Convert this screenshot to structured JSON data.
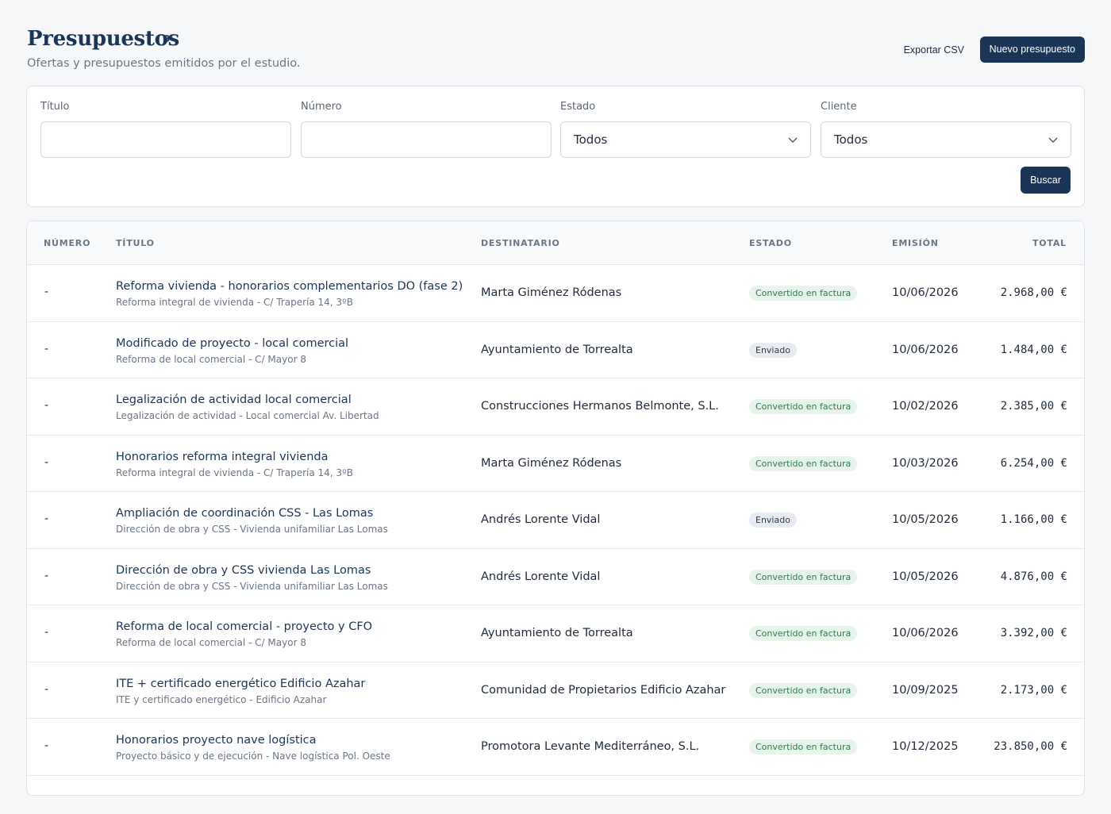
{
  "header": {
    "title": "Presupuestos",
    "count": "9",
    "subtitle": "Ofertas y presupuestos emitidos por el estudio.",
    "export_label": "Exportar CSV",
    "new_label": "Nuevo presupuesto"
  },
  "filters": {
    "title_label": "Título",
    "title_value": "",
    "number_label": "Número",
    "number_value": "",
    "status_label": "Estado",
    "status_value": "Todos",
    "client_label": "Cliente",
    "client_value": "Todos",
    "search_label": "Buscar"
  },
  "table": {
    "columns": {
      "number": "NÚMERO",
      "title": "TÍTULO",
      "recipient": "DESTINATARIO",
      "status": "ESTADO",
      "issued": "EMISIÓN",
      "total": "TOTAL"
    },
    "rows": [
      {
        "number": "-",
        "title": "Reforma vivienda - honorarios complementarios DO (fase 2)",
        "subtitle": "Reforma integral de vivienda - C/ Trapería 14, 3ºB",
        "recipient": "Marta Giménez Ródenas",
        "status": "Convertido en factura",
        "date": "10/06/2026",
        "total": "2.968,00 €"
      },
      {
        "number": "-",
        "title": "Modificado de proyecto - local comercial",
        "subtitle": "Reforma de local comercial - C/ Mayor 8",
        "recipient": "Ayuntamiento de Torrealta",
        "status": "Enviado",
        "date": "10/06/2026",
        "total": "1.484,00 €"
      },
      {
        "number": "-",
        "title": "Legalización de actividad local comercial",
        "subtitle": "Legalización de actividad - Local comercial Av. Libertad",
        "recipient": "Construcciones Hermanos Belmonte, S.L.",
        "status": "Convertido en factura",
        "date": "10/02/2026",
        "total": "2.385,00 €"
      },
      {
        "number": "-",
        "title": "Honorarios reforma integral vivienda",
        "subtitle": "Reforma integral de vivienda - C/ Trapería 14, 3ºB",
        "recipient": "Marta Giménez Ródenas",
        "status": "Convertido en factura",
        "date": "10/03/2026",
        "total": "6.254,00 €"
      },
      {
        "number": "-",
        "title": "Ampliación de coordinación CSS - Las Lomas",
        "subtitle": "Dirección de obra y CSS - Vivienda unifamiliar Las Lomas",
        "recipient": "Andrés Lorente Vidal",
        "status": "Enviado",
        "date": "10/05/2026",
        "total": "1.166,00 €"
      },
      {
        "number": "-",
        "title": "Dirección de obra y CSS vivienda Las Lomas",
        "subtitle": "Dirección de obra y CSS - Vivienda unifamiliar Las Lomas",
        "recipient": "Andrés Lorente Vidal",
        "status": "Convertido en factura",
        "date": "10/05/2026",
        "total": "4.876,00 €"
      },
      {
        "number": "-",
        "title": "Reforma de local comercial - proyecto y CFO",
        "subtitle": "Reforma de local comercial - C/ Mayor 8",
        "recipient": "Ayuntamiento de Torrealta",
        "status": "Convertido en factura",
        "date": "10/06/2026",
        "total": "3.392,00 €"
      },
      {
        "number": "-",
        "title": "ITE + certificado energético Edificio Azahar",
        "subtitle": "ITE y certificado energético - Edificio Azahar",
        "recipient": "Comunidad de Propietarios Edificio Azahar",
        "status": "Convertido en factura",
        "date": "10/09/2025",
        "total": "2.173,00 €"
      },
      {
        "number": "-",
        "title": "Honorarios proyecto nave logística",
        "subtitle": "Proyecto básico y de ejecución - Nave logística Pol. Oeste",
        "recipient": "Promotora Levante Mediterráneo, S.L.",
        "status": "Convertido en factura",
        "date": "10/12/2025",
        "total": "23.850,00 €"
      }
    ]
  },
  "colors": {
    "primary": "#1b3556",
    "status_converted_bg": "#e7f4ec",
    "status_converted_text": "#2f7a4d",
    "status_sent_bg": "#e8ebef",
    "status_sent_text": "#2e3b4e"
  },
  "icons": {
    "status_select": "chevron-down-icon",
    "client_select": "chevron-down-icon"
  }
}
